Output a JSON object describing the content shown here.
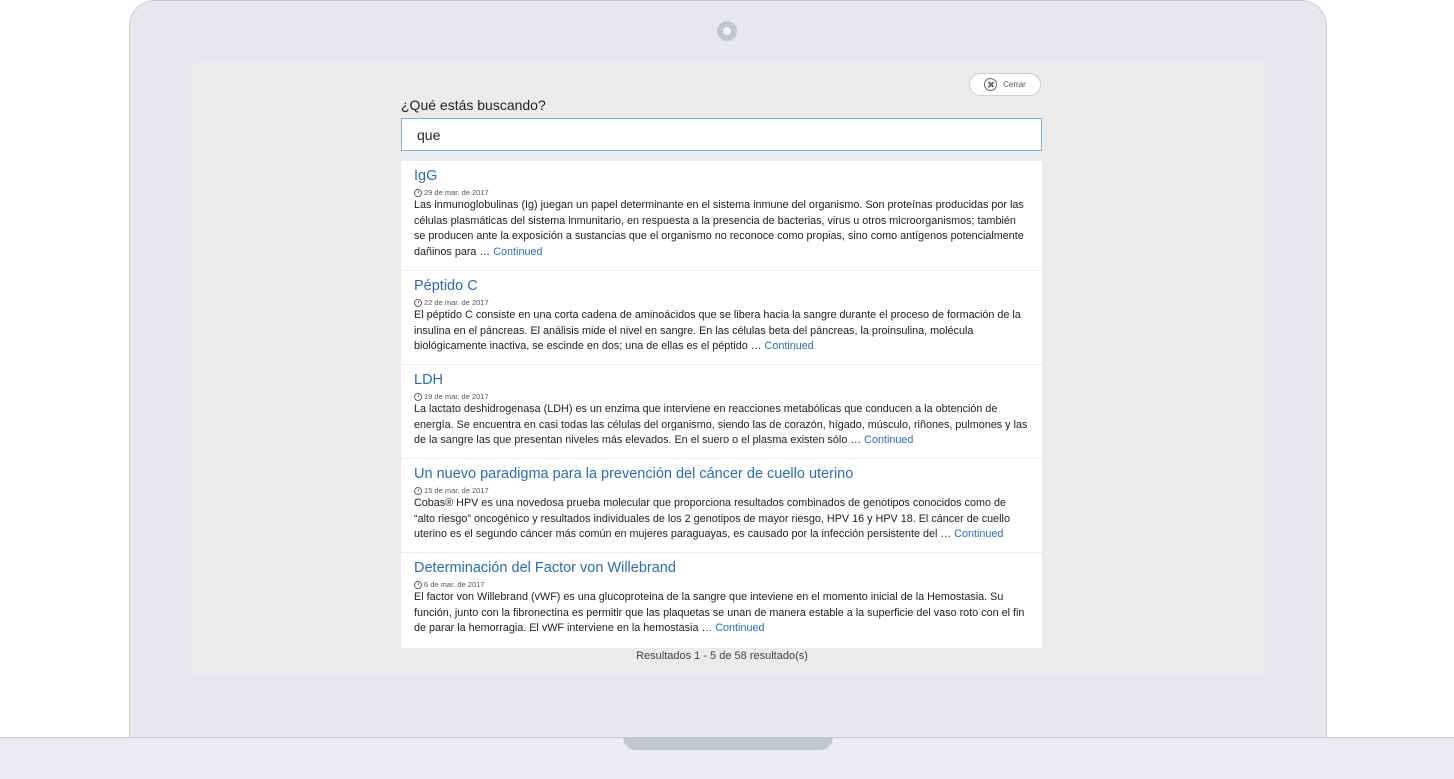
{
  "close_button": {
    "label": "Cerrar"
  },
  "search": {
    "heading": "¿Qué estás buscando?",
    "value": "que"
  },
  "results": [
    {
      "title": "IgG",
      "date": "29 de mar. de 2017",
      "excerpt": "Las inmunoglobulinas (Ig) juegan un papel determinante en el sistema inmune del organismo. Son proteínas producidas por las células plasmáticas del sistema inmunitario, en respuesta a la presencia de bacterias, virus u otros microorganismos; también se producen ante la exposición a sustancias que el organismo no reconoce como propias, sino como antígenos potencialmente dañinos para …",
      "more": "Continued"
    },
    {
      "title": "Péptido C",
      "date": "22 de mar. de 2017",
      "excerpt": "El péptido C consiste en una corta cadena de aminoácidos que se libera hacia la sangre durante el proceso de formación de la insulina en el páncreas. El análisis mide el nivel en sangre. En las células beta del páncreas, la proinsulina, molécula biológicamente inactiva, se escinde en dos; una de ellas es el péptido …",
      "more": "Continued"
    },
    {
      "title": "LDH",
      "date": "19 de mar. de 2017",
      "excerpt": "La lactato deshidrogenasa (LDH) es un enzima que interviene en reacciones metabólicas que conducen a la obtención de energía. Se encuentra en casi todas las células del organismo, siendo las de corazón, hígado, músculo, riñones, pulmones y las de la sangre las que presentan niveles más elevados. En el suero o el plasma existen sólo …",
      "more": "Continued"
    },
    {
      "title": "Un nuevo paradigma para la prevención del cáncer de cuello uterino",
      "date": "15 de mar. de 2017",
      "excerpt": "Cobas® HPV es una novedosa prueba molecular que proporciona resultados combinados de genotipos conocidos como de “alto riesgo” oncogénico y resultados individuales de los 2 genotipos de mayor riesgo, HPV 16 y HPV 18. El cáncer de cuello uterino es el segundo cáncer más común en mujeres paraguayas, es causado por la infección persistente del …",
      "more": "Continued"
    },
    {
      "title": "Determinación del Factor von Willebrand",
      "date": "6 de mar. de 2017",
      "excerpt": "El factor von Willebrand (vWF) es una glucoproteina de la sangre que inteviene en el momento inicial de la Hemostasia. Su función, junto con la fibronectina es permitir que las plaquetas se unan de manera estable a la superficie del vaso roto con el fin de parar la hemorragia. El vWF interviene en la hemostasia …",
      "more": "Continued"
    }
  ],
  "results_count": "Resultados 1 - 5 de 58 resultado(s)"
}
